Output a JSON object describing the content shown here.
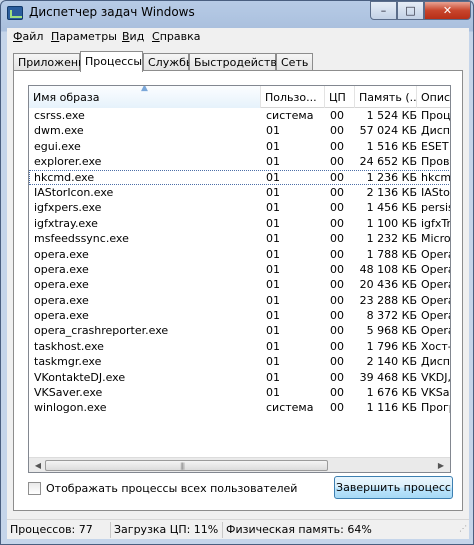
{
  "window": {
    "title": "Диспетчер задач Windows",
    "minimize": "–",
    "maximize": "□",
    "close": "✕"
  },
  "menu": [
    "Файл",
    "Параметры",
    "Вид",
    "Справка"
  ],
  "tabs": [
    "Приложения",
    "Процессы",
    "Службы",
    "Быстродействие",
    "Сеть"
  ],
  "active_tab": "Процессы",
  "columns": [
    "Имя образа",
    "Пользо...",
    "ЦП",
    "Память (...",
    "Описа"
  ],
  "processes": [
    {
      "name": "csrss.exe",
      "user": "система",
      "cpu": "00",
      "memory": "1 524 КБ",
      "desc": "Проц"
    },
    {
      "name": "dwm.exe",
      "user": "01",
      "cpu": "00",
      "memory": "57 024 КБ",
      "desc": "Диспе"
    },
    {
      "name": "egui.exe",
      "user": "01",
      "cpu": "00",
      "memory": "1 516 КБ",
      "desc": "ESET N"
    },
    {
      "name": "explorer.exe",
      "user": "01",
      "cpu": "00",
      "memory": "24 652 КБ",
      "desc": "Прово"
    },
    {
      "name": "hkcmd.exe",
      "user": "01",
      "cpu": "00",
      "memory": "1 236 КБ",
      "desc": "hkcmd"
    },
    {
      "name": "IAStorIcon.exe",
      "user": "01",
      "cpu": "00",
      "memory": "2 136 КБ",
      "desc": "IAStor"
    },
    {
      "name": "igfxpers.exe",
      "user": "01",
      "cpu": "00",
      "memory": "1 456 КБ",
      "desc": "persist"
    },
    {
      "name": "igfxtray.exe",
      "user": "01",
      "cpu": "00",
      "memory": "1 100 КБ",
      "desc": "igfxTra"
    },
    {
      "name": "msfeedssync.exe",
      "user": "01",
      "cpu": "00",
      "memory": "1 232 КБ",
      "desc": "Micros"
    },
    {
      "name": "opera.exe",
      "user": "01",
      "cpu": "00",
      "memory": "1 788 КБ",
      "desc": "Opera"
    },
    {
      "name": "opera.exe",
      "user": "01",
      "cpu": "00",
      "memory": "48 108 КБ",
      "desc": "Opera"
    },
    {
      "name": "opera.exe",
      "user": "01",
      "cpu": "00",
      "memory": "20 436 КБ",
      "desc": "Opera"
    },
    {
      "name": "opera.exe",
      "user": "01",
      "cpu": "00",
      "memory": "23 288 КБ",
      "desc": "Opera"
    },
    {
      "name": "opera.exe",
      "user": "01",
      "cpu": "00",
      "memory": "8 372 КБ",
      "desc": "Opera"
    },
    {
      "name": "opera_crashreporter.exe",
      "user": "01",
      "cpu": "00",
      "memory": "5 968 КБ",
      "desc": "Opera"
    },
    {
      "name": "taskhost.exe",
      "user": "01",
      "cpu": "00",
      "memory": "1 796 КБ",
      "desc": "Хост-п"
    },
    {
      "name": "taskmgr.exe",
      "user": "01",
      "cpu": "00",
      "memory": "2 140 КБ",
      "desc": "Диспе"
    },
    {
      "name": "VKontakteDJ.exe",
      "user": "01",
      "cpu": "00",
      "memory": "39 468 КБ",
      "desc": "VKDJ,"
    },
    {
      "name": "VKSaver.exe",
      "user": "01",
      "cpu": "00",
      "memory": "1 676 КБ",
      "desc": "VKSave"
    },
    {
      "name": "winlogon.exe",
      "user": "система",
      "cpu": "00",
      "memory": "1 116 КБ",
      "desc": "Програ"
    }
  ],
  "selected_row": "hkcmd.exe",
  "show_all_users_label": "Отображать процессы всех пользователей",
  "show_all_users_checked": false,
  "end_process_label": "Завершить процесс",
  "status": {
    "processes": "Процессов: 77",
    "cpu": "Загрузка ЦП: 11%",
    "memory": "Физическая память: 64%"
  }
}
